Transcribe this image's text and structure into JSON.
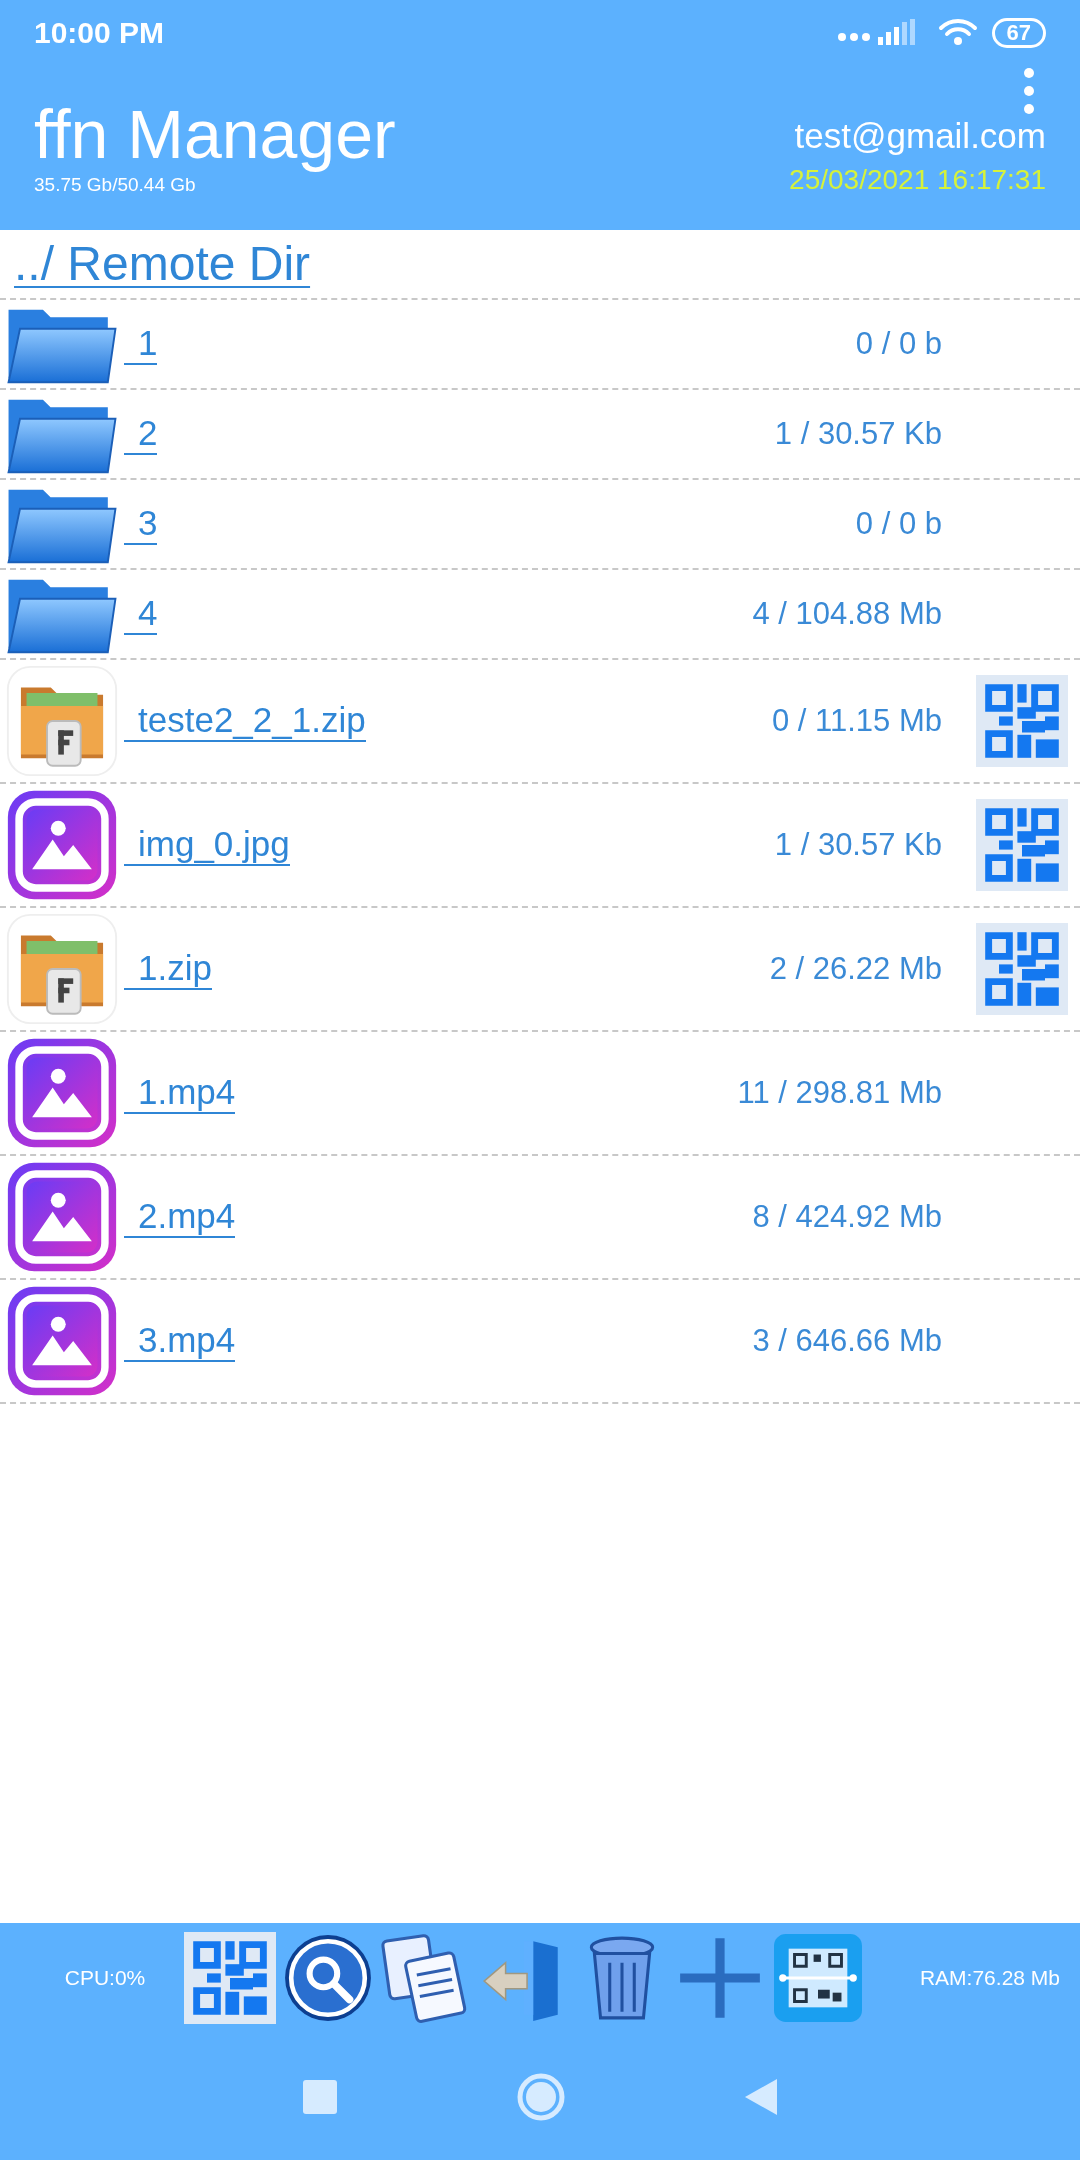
{
  "status_bar": {
    "time": "10:00 PM",
    "battery": "67"
  },
  "header": {
    "title": "ffn Manager",
    "storage": "35.75 Gb/50.44 Gb",
    "account": "test@gmail.com",
    "datetime": "25/03/2021 16:17:31"
  },
  "parent_link": "../ Remote Dir",
  "files": [
    {
      "kind": "folder",
      "name": "1",
      "size": "0 / 0 b",
      "qr_button": false
    },
    {
      "kind": "folder",
      "name": "2",
      "size": "1 / 30.57 Kb",
      "qr_button": false
    },
    {
      "kind": "folder",
      "name": "3",
      "size": "0 / 0 b",
      "qr_button": false
    },
    {
      "kind": "folder",
      "name": "4",
      "size": "4 / 104.88 Mb",
      "qr_button": false
    },
    {
      "kind": "archive",
      "name": "teste2_2_1.zip",
      "size": "0 / 11.15 Mb",
      "qr_button": true
    },
    {
      "kind": "image",
      "name": "img_0.jpg",
      "size": "1 / 30.57 Kb",
      "qr_button": true
    },
    {
      "kind": "archive",
      "name": "1.zip",
      "size": "2 / 26.22 Mb",
      "qr_button": true
    },
    {
      "kind": "image",
      "name": "1.mp4",
      "size": "11 / 298.81 Mb",
      "qr_button": false
    },
    {
      "kind": "image",
      "name": "2.mp4",
      "size": "8 / 424.92 Mb",
      "qr_button": false
    },
    {
      "kind": "image",
      "name": "3.mp4",
      "size": "3 / 646.66 Mb",
      "qr_button": false
    }
  ],
  "toolbar": {
    "cpu": "CPU:0%",
    "ram": "RAM:76.28 Mb",
    "buttons": [
      {
        "kind": "qr"
      },
      {
        "kind": "search"
      },
      {
        "kind": "copy"
      },
      {
        "kind": "exit"
      },
      {
        "kind": "trash"
      },
      {
        "kind": "add"
      },
      {
        "kind": "scan"
      }
    ]
  }
}
